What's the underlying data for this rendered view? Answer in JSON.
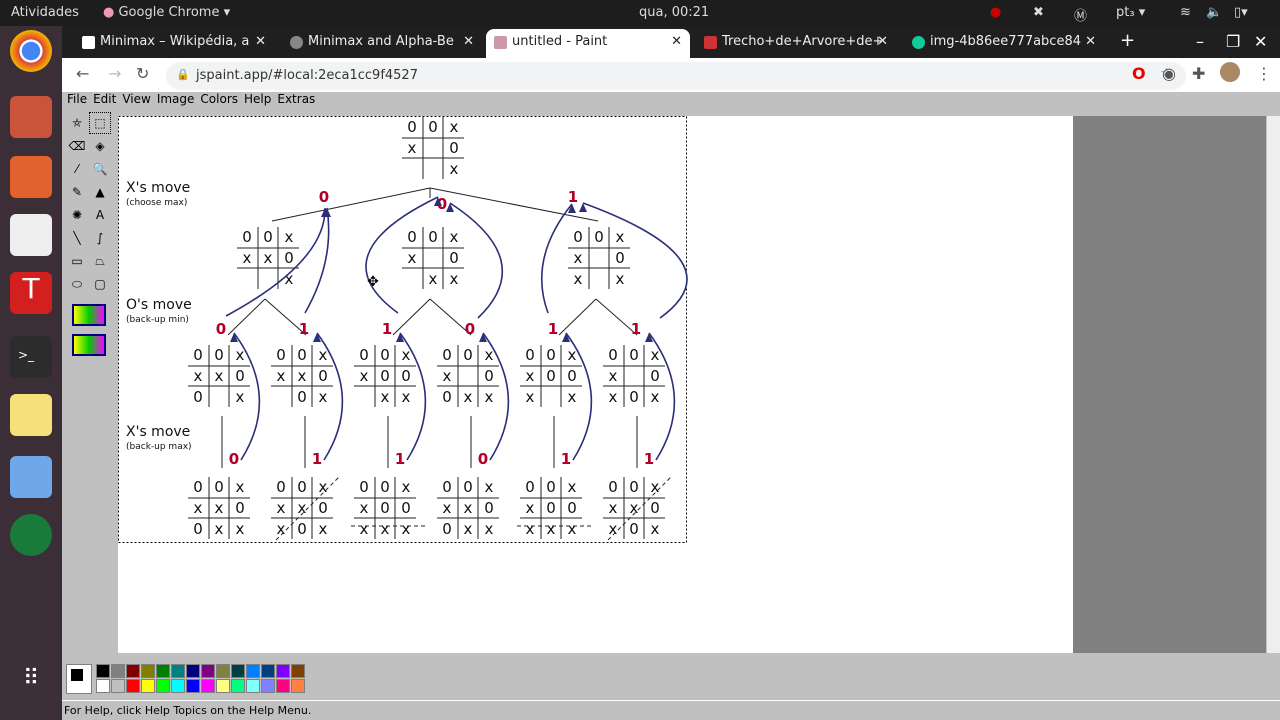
{
  "system": {
    "activities": "Atividades",
    "app_menu": "Google Chrome ▾",
    "clock": "qua, 00:21",
    "lang": "pt₃ ▾"
  },
  "browser": {
    "tabs": [
      {
        "label": "Minimax – Wikipédia, a",
        "active": false
      },
      {
        "label": "Minimax and Alpha-Be",
        "active": false
      },
      {
        "label": "untitled - Paint",
        "active": true
      },
      {
        "label": "Trecho+de+Arvore+de+",
        "active": false
      },
      {
        "label": "img-4b86ee777abce84",
        "active": false
      }
    ],
    "url": "jspaint.app/#local:2eca1cc9f4527"
  },
  "paint": {
    "menu": [
      "File",
      "Edit",
      "View",
      "Image",
      "Colors",
      "Help",
      "Extras"
    ],
    "status": "For Help, click Help Topics on the Help Menu.",
    "palette": [
      "#000000",
      "#808080",
      "#800000",
      "#808000",
      "#008000",
      "#008080",
      "#000080",
      "#800080",
      "#808040",
      "#004040",
      "#0080ff",
      "#004080",
      "#8000ff",
      "#804000",
      "#ffffff",
      "#c0c0c0",
      "#ff0000",
      "#ffff00",
      "#00ff00",
      "#00ffff",
      "#0000ff",
      "#ff00ff",
      "#ffff80",
      "#00ff80",
      "#80ffff",
      "#8080ff",
      "#ff0080",
      "#ff8040"
    ]
  },
  "diagram": {
    "labels": [
      {
        "title": "X's move",
        "sub": "(choose max)"
      },
      {
        "title": "O's move",
        "sub": "(back-up min)"
      },
      {
        "title": "X's move",
        "sub": "(back-up max)"
      }
    ],
    "root": [
      [
        "0",
        "0",
        "x"
      ],
      [
        "x",
        "",
        "0"
      ],
      [
        "",
        "",
        "x"
      ]
    ],
    "level1": [
      {
        "board": [
          [
            "0",
            "0",
            "x"
          ],
          [
            "x",
            "x",
            "0"
          ],
          [
            "",
            "",
            "x"
          ]
        ],
        "value": "0"
      },
      {
        "board": [
          [
            "0",
            "0",
            "x"
          ],
          [
            "x",
            "",
            "0"
          ],
          [
            "",
            "x",
            "x"
          ]
        ],
        "value": "0"
      },
      {
        "board": [
          [
            "0",
            "0",
            "x"
          ],
          [
            "x",
            "",
            "0"
          ],
          [
            "x",
            "",
            "x"
          ]
        ],
        "value": "1"
      }
    ],
    "level2": [
      {
        "board": [
          [
            "0",
            "0",
            "x"
          ],
          [
            "x",
            "x",
            "0"
          ],
          [
            "0",
            "",
            "x"
          ]
        ],
        "value": "0"
      },
      {
        "board": [
          [
            "0",
            "0",
            "x"
          ],
          [
            "x",
            "x",
            "0"
          ],
          [
            "",
            "0",
            "x"
          ]
        ],
        "value": "1"
      },
      {
        "board": [
          [
            "0",
            "0",
            "x"
          ],
          [
            "x",
            "0",
            "0"
          ],
          [
            "",
            "x",
            "x"
          ]
        ],
        "value": "1"
      },
      {
        "board": [
          [
            "0",
            "0",
            "x"
          ],
          [
            "x",
            "",
            "0"
          ],
          [
            "0",
            "x",
            "x"
          ]
        ],
        "value": "0"
      },
      {
        "board": [
          [
            "0",
            "0",
            "x"
          ],
          [
            "x",
            "0",
            "0"
          ],
          [
            "x",
            "",
            "x"
          ]
        ],
        "value": "1"
      },
      {
        "board": [
          [
            "0",
            "0",
            "x"
          ],
          [
            "x",
            "",
            "0"
          ],
          [
            "x",
            "0",
            "x"
          ]
        ],
        "value": "1"
      }
    ],
    "level3": [
      {
        "board": [
          [
            "0",
            "0",
            "x"
          ],
          [
            "x",
            "x",
            "0"
          ],
          [
            "0",
            "x",
            "x"
          ]
        ],
        "value": "0",
        "win": "none"
      },
      {
        "board": [
          [
            "0",
            "0",
            "x"
          ],
          [
            "x",
            "x",
            "0"
          ],
          [
            "x",
            "0",
            "x"
          ]
        ],
        "value": "1",
        "win": "diagonal"
      },
      {
        "board": [
          [
            "0",
            "0",
            "x"
          ],
          [
            "x",
            "0",
            "0"
          ],
          [
            "x",
            "x",
            "x"
          ]
        ],
        "value": "1",
        "win": "row"
      },
      {
        "board": [
          [
            "0",
            "0",
            "x"
          ],
          [
            "x",
            "x",
            "0"
          ],
          [
            "0",
            "x",
            "x"
          ]
        ],
        "value": "0",
        "win": "none"
      },
      {
        "board": [
          [
            "0",
            "0",
            "x"
          ],
          [
            "x",
            "0",
            "0"
          ],
          [
            "x",
            "x",
            "x"
          ]
        ],
        "value": "1",
        "win": "row"
      },
      {
        "board": [
          [
            "0",
            "0",
            "x"
          ],
          [
            "x",
            "x",
            "0"
          ],
          [
            "x",
            "0",
            "x"
          ]
        ],
        "value": "1",
        "win": "diagonal"
      }
    ],
    "value_color": "#b0002a",
    "arrow_color": "#2b2f7a"
  }
}
